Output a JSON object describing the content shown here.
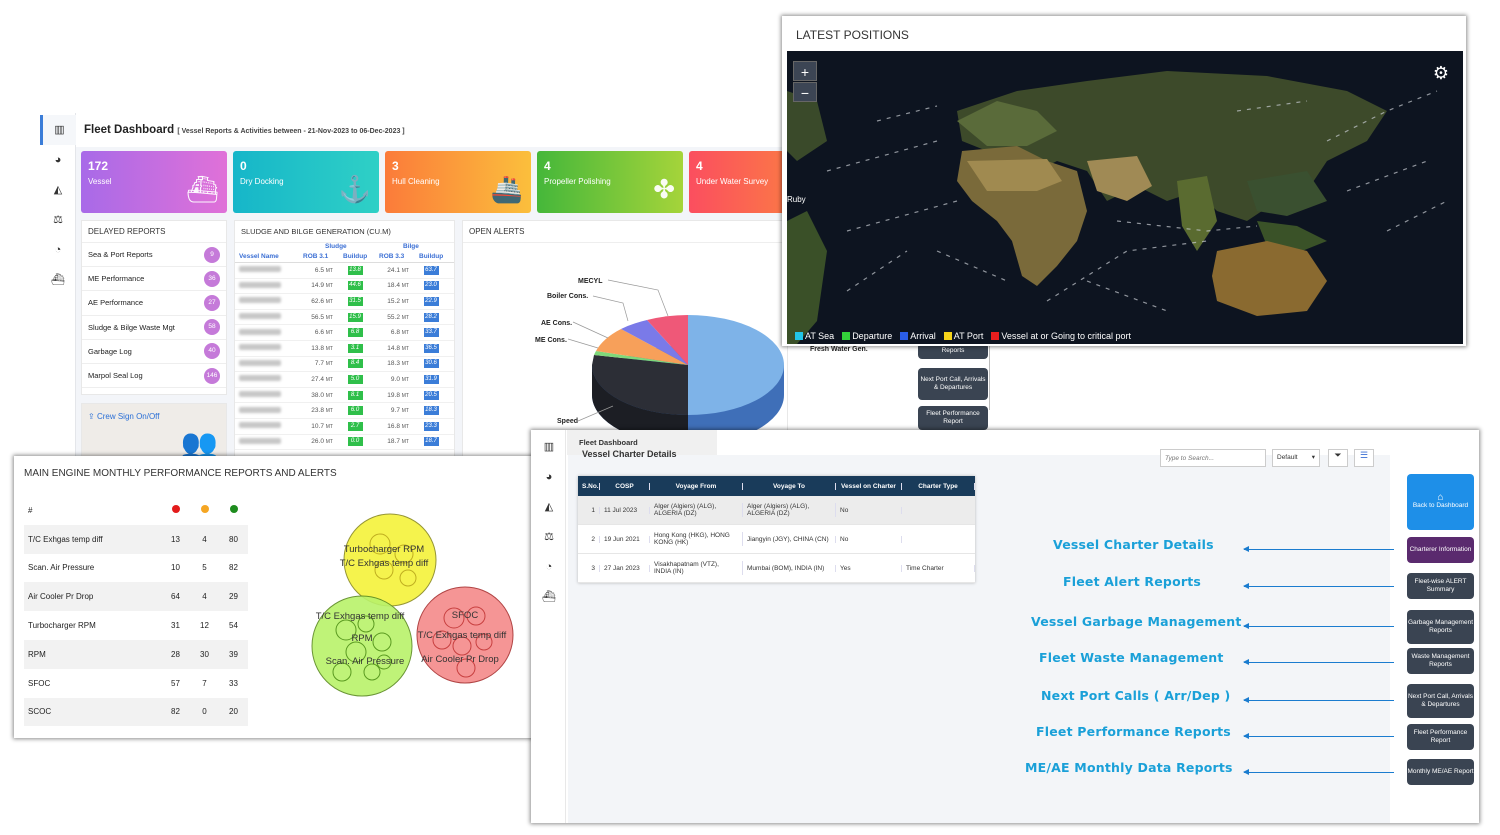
{
  "fleet": {
    "title": "Fleet Dashboard",
    "subtitle": "[ Vessel Reports & Activities between - 21-Nov-2023 to 06-Dec-2023 ]",
    "cards": [
      {
        "value": "172",
        "label": "Vessel",
        "color": "#b36ae8"
      },
      {
        "value": "0",
        "label": "Dry Docking",
        "color": "#1fbcc8"
      },
      {
        "value": "3",
        "label": "Hull Cleaning",
        "color": "#fb8a3c"
      },
      {
        "value": "4",
        "label": "Propeller Polishing",
        "color": "#5cc23a"
      },
      {
        "value": "4",
        "label": "Under Water Survey",
        "color": "#fb5f5f"
      }
    ],
    "delayed_title": "DELAYED REPORTS",
    "delayed": [
      {
        "label": "Sea & Port Reports",
        "count": "9",
        "color": "#c57ad9"
      },
      {
        "label": "ME Performance",
        "count": "36",
        "color": "#c57ad9"
      },
      {
        "label": "AE Performance",
        "count": "27",
        "color": "#c57ad9"
      },
      {
        "label": "Sludge & Bilge Waste Mgt",
        "count": "58",
        "color": "#c57ad9"
      },
      {
        "label": "Garbage Log",
        "count": "40",
        "color": "#c57ad9"
      },
      {
        "label": "Marpol Seal Log",
        "count": "146",
        "color": "#c57ad9"
      }
    ],
    "crew_label": "Crew Sign On/Off",
    "sludge_title": "SLUDGE AND BILGE GENERATION (Cu.m)",
    "sludge_headers": {
      "vessel": "Vessel Name",
      "sludge": "Sludge",
      "bilge": "Bilge",
      "rob1": "ROB 3.1",
      "buildup1": "Buildup",
      "rob2": "ROB 3.3",
      "buildup2": "Buildup",
      "unit": "MT"
    },
    "sludge_rows": [
      {
        "rob1": "6.5",
        "bu1": "13.8",
        "rob2": "24.1",
        "bu2": "63.7"
      },
      {
        "rob1": "14.9",
        "bu1": "44.6",
        "rob2": "18.4",
        "bu2": "23.0"
      },
      {
        "rob1": "62.6",
        "bu1": "31.5",
        "rob2": "15.2",
        "bu2": "22.9"
      },
      {
        "rob1": "56.5",
        "bu1": "15.9",
        "rob2": "55.2",
        "bu2": "28.2"
      },
      {
        "rob1": "6.6",
        "bu1": "6.8",
        "rob2": "6.8",
        "bu2": "33.7"
      },
      {
        "rob1": "13.8",
        "bu1": "3.1",
        "rob2": "14.8",
        "bu2": "36.5"
      },
      {
        "rob1": "7.7",
        "bu1": "8.4",
        "rob2": "18.3",
        "bu2": "30.6"
      },
      {
        "rob1": "27.4",
        "bu1": "5.0",
        "rob2": "9.0",
        "bu2": "31.9"
      },
      {
        "rob1": "38.0",
        "bu1": "8.1",
        "rob2": "19.8",
        "bu2": "20.5"
      },
      {
        "rob1": "23.8",
        "bu1": "6.0",
        "rob2": "9.7",
        "bu2": "18.3"
      },
      {
        "rob1": "10.7",
        "bu1": "2.7",
        "rob2": "16.8",
        "bu2": "23.3"
      },
      {
        "rob1": "26.0",
        "bu1": "0.0",
        "rob2": "18.7",
        "bu2": "18.7"
      }
    ],
    "alerts_title": "OPEN ALERTS",
    "pie_labels": [
      "MECYL",
      "Boiler Cons.",
      "AE Cons.",
      "ME Cons.",
      "Speed",
      "Fresh Water Gen."
    ]
  },
  "side_buttons_mid": [
    "Reports",
    "Next Port Call, Arrivals & Departures",
    "Fleet Performance Report"
  ],
  "map": {
    "title": "LATEST POSITIONS",
    "zoom_in": "+",
    "zoom_out": "−",
    "place_label": "Ruby",
    "legend": [
      {
        "label": "AT Sea",
        "color": "#22c4e8"
      },
      {
        "label": "Departure",
        "color": "#33d23a"
      },
      {
        "label": "Arrival",
        "color": "#2a5de8"
      },
      {
        "label": "AT Port",
        "color": "#f5d31a"
      },
      {
        "label": "Vessel at or Going to critical port",
        "color": "#e81e1e"
      }
    ]
  },
  "me": {
    "title": "MAIN ENGINE MONTHLY PERFORMANCE REPORTS AND ALERTS",
    "head": "#",
    "dot_colors": [
      "#e31b1b",
      "#f5a623",
      "#1e8c1e"
    ],
    "rows": [
      {
        "label": "T/C Exhgas temp diff",
        "a": "13",
        "b": "4",
        "c": "80"
      },
      {
        "label": "Scan. Air Pressure",
        "a": "10",
        "b": "5",
        "c": "82"
      },
      {
        "label": "Air Cooler Pr Drop",
        "a": "64",
        "b": "4",
        "c": "29"
      },
      {
        "label": "Turbocharger RPM",
        "a": "31",
        "b": "12",
        "c": "54"
      },
      {
        "label": "RPM",
        "a": "28",
        "b": "30",
        "c": "39"
      },
      {
        "label": "SFOC",
        "a": "57",
        "b": "7",
        "c": "33"
      },
      {
        "label": "SCOC",
        "a": "82",
        "b": "0",
        "c": "20"
      }
    ],
    "bubbles": {
      "yellow": [
        "Turbocharger RPM",
        "T/C Exhgas temp diff"
      ],
      "green": [
        "T/C Exhgas temp diff",
        "RPM",
        "Scan. Air Pressure"
      ],
      "red": [
        "SFOC",
        "T/C Exhgas temp diff",
        "Air Cooler Pr Drop"
      ]
    }
  },
  "vc": {
    "header": "Fleet Dashboard",
    "section": "Vessel Charter Details",
    "search_placeholder": "Type to Search...",
    "select_value": "Default",
    "columns": [
      "S.No.",
      "COSP",
      "Voyage From",
      "Voyage To",
      "Vessel on Charter",
      "Charter Type"
    ],
    "rows": [
      [
        "1",
        "11 Jul 2023",
        "Alger (Algiers) (ALG), ALGERIA (DZ)",
        "Alger (Algiers) (ALG), ALGERIA (DZ)",
        "No",
        ""
      ],
      [
        "2",
        "19 Jun 2021",
        "Hong Kong (HKG), HONG KONG (HK)",
        "Jiangyin (JGY), CHINA (CN)",
        "No",
        ""
      ],
      [
        "3",
        "27 Jan 2023",
        "Visakhapatnam (VTZ), INDIA (IN)",
        "Mumbai (BOM), INDIA (IN)",
        "Yes",
        "Time Charter"
      ]
    ],
    "links": [
      "Vessel Charter Details",
      "Fleet Alert Reports",
      "Vessel Garbage Management",
      "Fleet Waste Management",
      "Next Port Calls ( Arr/Dep )",
      "Fleet Performance Reports",
      "ME/AE Monthly Data Reports"
    ],
    "back_label": "Back to Dashboard",
    "right_buttons": [
      "Charterer Information",
      "Fleet-wise ALERT Summary",
      "Garbage Management Reports",
      "Waste Management Reports",
      "Next Port Call, Arrivals & Departures",
      "Fleet Performance Report",
      "Monthly ME/AE Report"
    ]
  }
}
